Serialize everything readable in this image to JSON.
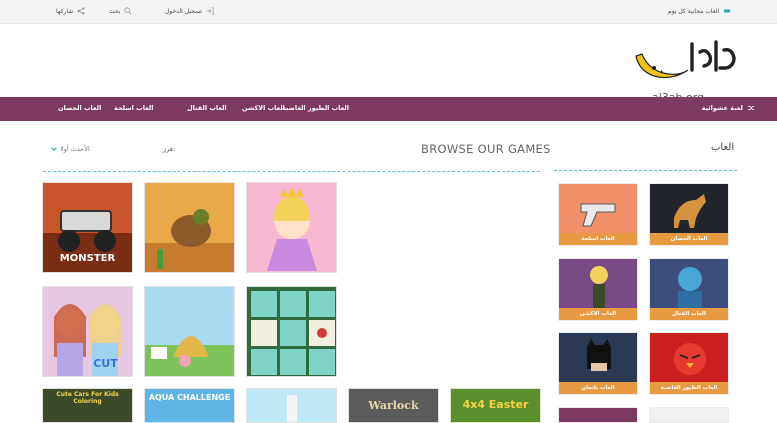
{
  "topbar": {
    "daily_games": "العاب مجانية كل يوم",
    "login": "تسجيل الدخول",
    "search": "بحث",
    "share": "شاركها"
  },
  "logo": {
    "subtitle": "al3ab.org"
  },
  "nav": {
    "items": [
      "العاب الطيور الغاضبة",
      "العاب الاكشن",
      "العاب القتال",
      "العاب اسلحة",
      "العاب الحصان"
    ],
    "random": "لعبة عشوائية"
  },
  "main": {
    "heading": "BROWSE OUR GAMES",
    "sort_label": "فرز:",
    "sort_value": "الأحدث أولا",
    "tiles": [
      {
        "label": "MONSTER"
      },
      {
        "label": ""
      },
      {
        "label": ""
      },
      {
        "label": "CUT"
      },
      {
        "label": ""
      },
      {
        "label": ""
      },
      {
        "label": "Cute Cars For Kids Coloring"
      },
      {
        "label": "AQUA CHALLENGE"
      },
      {
        "label": ""
      },
      {
        "label": "Warlock"
      },
      {
        "label": "4x4 Easter"
      }
    ]
  },
  "sidebar": {
    "title": "العاب",
    "categories": [
      {
        "label": "العاب الحصان"
      },
      {
        "label": "العاب اسلحة"
      },
      {
        "label": "العاب القتال"
      },
      {
        "label": "العاب الاكشن"
      },
      {
        "label": "العاب الطيور الغاضبة"
      },
      {
        "label": "العاب باتمان"
      }
    ]
  },
  "colors": {
    "nav_bg": "#7d3a60",
    "accent_orange": "#e89a43",
    "dash": "#5fc3cf"
  }
}
